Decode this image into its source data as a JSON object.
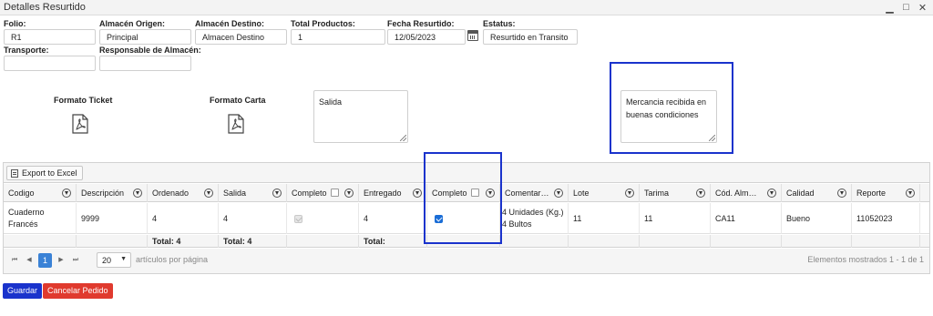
{
  "window": {
    "title": "Detalles Resurtido"
  },
  "form": {
    "folio": {
      "label": "Folio:",
      "value": "R1"
    },
    "almacen_origen": {
      "label": "Almacén Origen:",
      "value": "Principal"
    },
    "almacen_destino": {
      "label": "Almacén Destino:",
      "value": "Almacen Destino"
    },
    "total_productos": {
      "label": "Total Productos:",
      "value": "1"
    },
    "fecha_resurtido": {
      "label": "Fecha Resurtido:",
      "value": "12/05/2023"
    },
    "estatus": {
      "label": "Estatus:",
      "value": "Resurtido en Transito"
    },
    "transporte": {
      "label": "Transporte:",
      "value": ""
    },
    "responsable": {
      "label": "Responsable de Almacén:",
      "value": ""
    }
  },
  "formatos": {
    "ticket_label": "Formato Ticket",
    "carta_label": "Formato Carta",
    "icon": "pdf-icon"
  },
  "comments": {
    "salida": "Salida",
    "entrega": "Mercancia recibida en buenas condiciones"
  },
  "grid": {
    "toolbar": {
      "export_label": "Export to Excel"
    },
    "columns": [
      "Codigo",
      "Descripción",
      "Ordenado",
      "Salida",
      "Completo",
      "Entregado",
      "Completo",
      "Comentar…",
      "Lote",
      "Tarima",
      "Cód. Alm…",
      "Calidad",
      "Reporte"
    ],
    "rows": [
      {
        "codigo": "Cuaderno\nFrancés",
        "descripcion": "9999",
        "ordenado": "4",
        "salida": "4",
        "completo_salida": true,
        "entregado": "4",
        "completo_entrega": true,
        "comentario": "4 Unidades (Kg.)\n4 Bultos",
        "lote": "11",
        "tarima": "11",
        "cod_almacen": "CA11",
        "calidad": "Bueno",
        "reporte": "11052023"
      }
    ],
    "totals": {
      "ordenado": "Total: 4",
      "salida": "Total: 4",
      "entregado": "Total:"
    },
    "pager": {
      "current_page": "1",
      "page_size": "20",
      "per_page_label": "artículos por página",
      "shown_label": "Elementos mostrados 1 - 1 de 1"
    }
  },
  "actions": {
    "save": "Guardar",
    "cancel": "Cancelar Pedido"
  },
  "colors": {
    "primary": "#1a33cc",
    "danger": "#e03a2e",
    "highlight": "#1a33cc",
    "pager_active": "#3a82d6"
  }
}
